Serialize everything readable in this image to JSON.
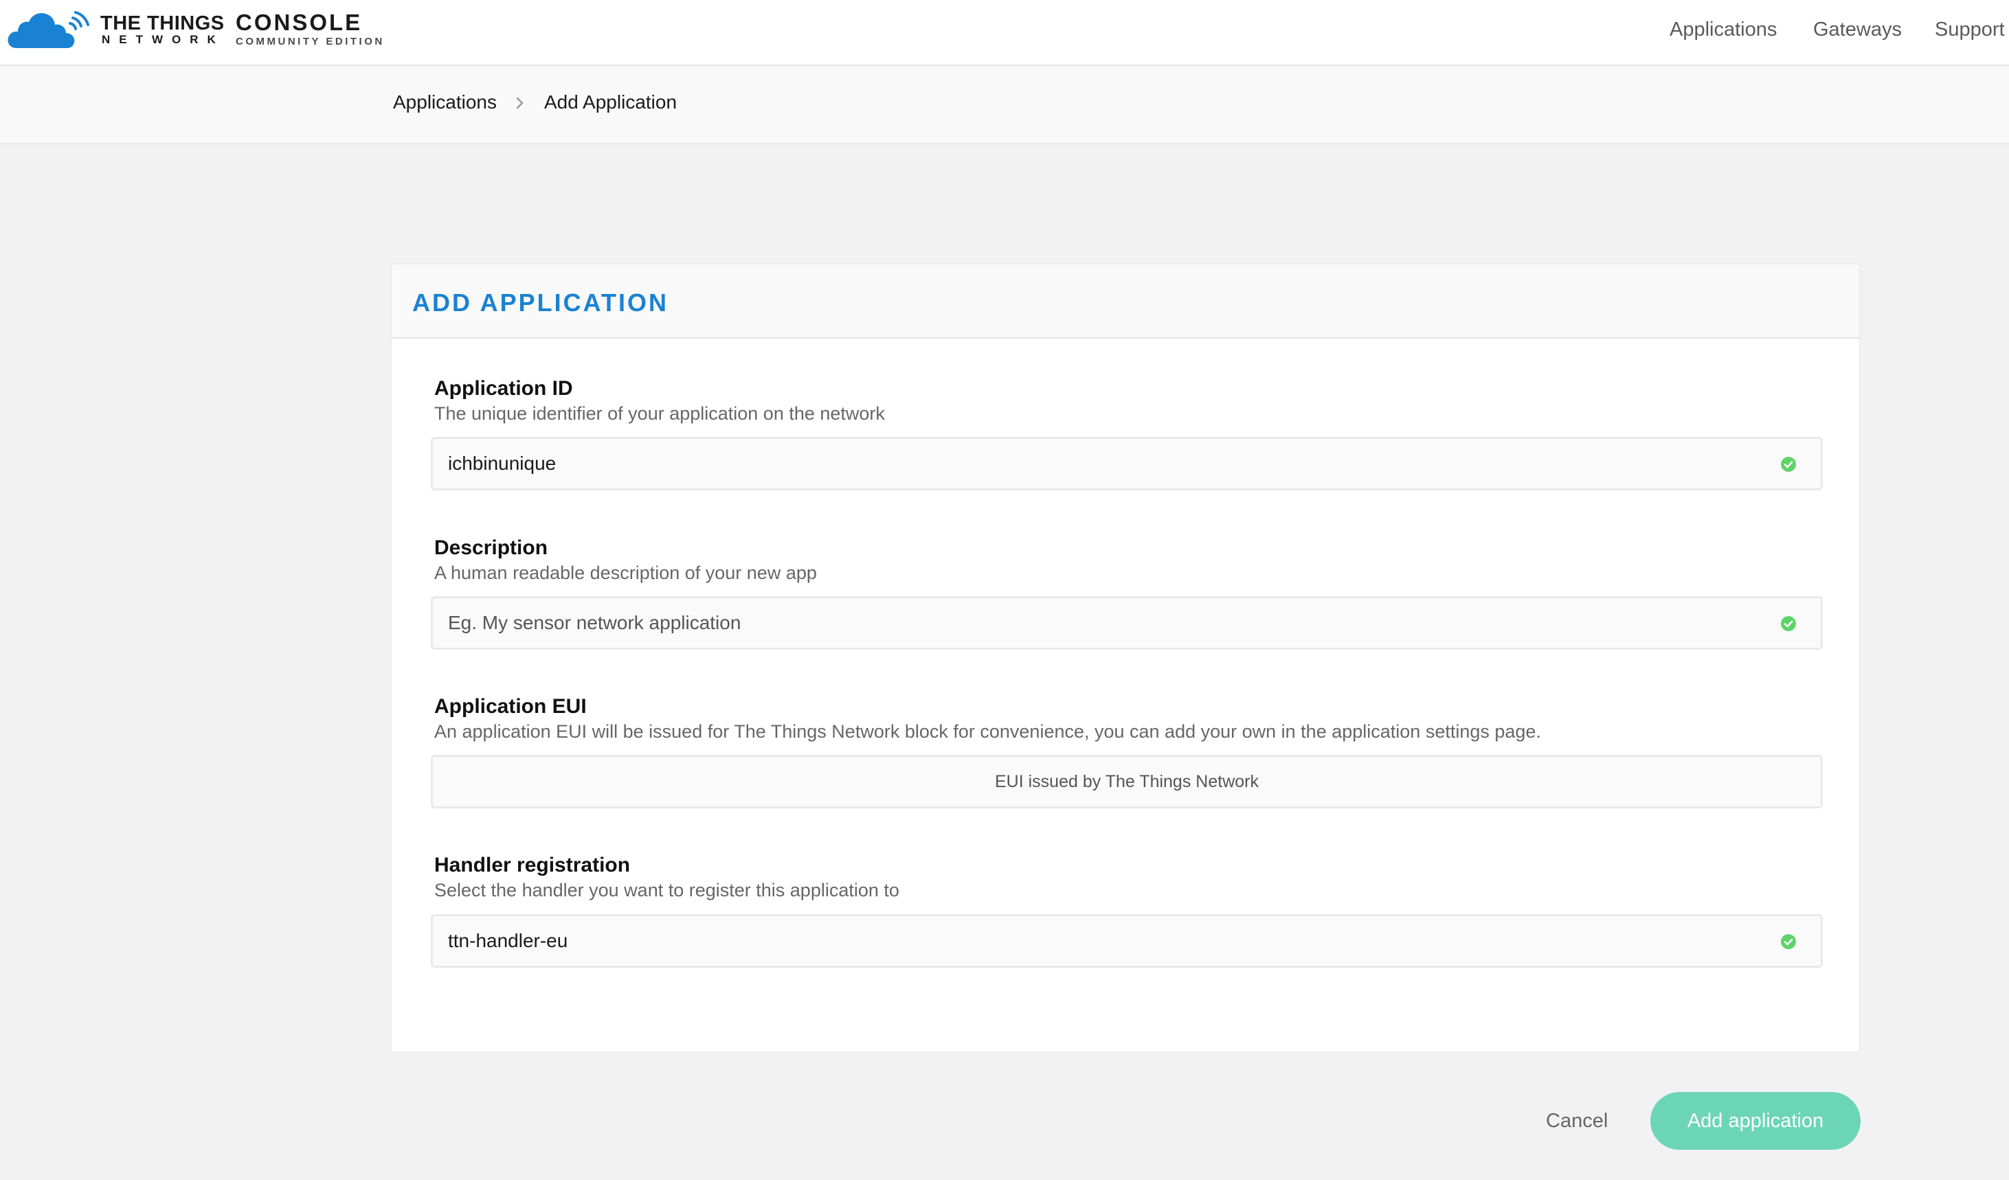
{
  "header": {
    "brand_line1": "THE THINGS",
    "brand_line2": "NETWORK",
    "console_title": "CONSOLE",
    "console_subtitle": "COMMUNITY EDITION",
    "nav": [
      "Applications",
      "Gateways",
      "Support"
    ]
  },
  "breadcrumb": {
    "items": [
      "Applications",
      "Add Application"
    ]
  },
  "form": {
    "title": "ADD APPLICATION",
    "fields": [
      {
        "label": "Application ID",
        "help": "The unique identifier of your application on the network",
        "value": "ichbinunique",
        "placeholder": "",
        "status_icon": "check-circle-icon"
      },
      {
        "label": "Description",
        "help": "A human readable description of your new app",
        "value": "",
        "placeholder": "Eg. My sensor network application",
        "status_icon": "check-circle-icon"
      },
      {
        "label": "Application EUI",
        "help": "An application EUI will be issued for The Things Network block for convenience, you can add your own in the application settings page.",
        "value": "EUI issued by The Things Network"
      },
      {
        "label": "Handler registration",
        "help": "Select the handler you want to register this application to",
        "value": "ttn-handler-eu",
        "placeholder": "",
        "status_icon": "check-circle-icon"
      }
    ]
  },
  "actions": {
    "cancel_label": "Cancel",
    "submit_label": "Add application"
  },
  "colors": {
    "accent_blue": "#1a82d2",
    "valid_green": "#5fd36a",
    "submit_button": "#6cd5b6"
  }
}
